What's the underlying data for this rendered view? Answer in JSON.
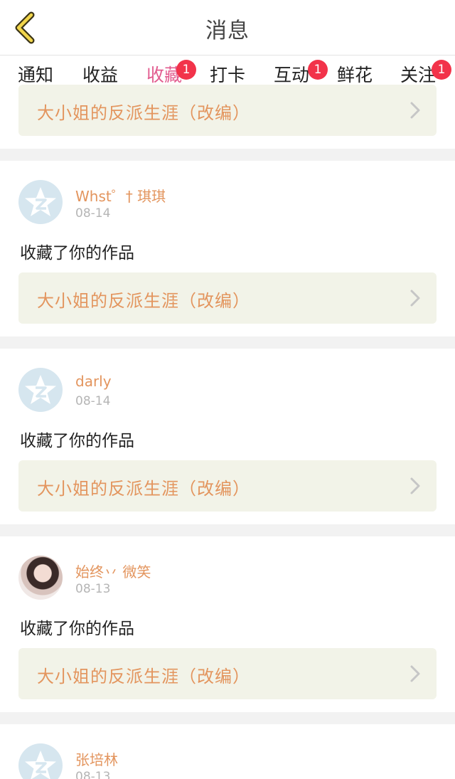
{
  "header": {
    "title": "消息"
  },
  "tabs": [
    {
      "label": "通知",
      "badge": ""
    },
    {
      "label": "收益",
      "badge": ""
    },
    {
      "label": "收藏",
      "badge": "1"
    },
    {
      "label": "打卡",
      "badge": ""
    },
    {
      "label": "互动",
      "badge": "1"
    },
    {
      "label": "鲜花",
      "badge": ""
    },
    {
      "label": "关注",
      "badge": "1"
    }
  ],
  "active_tab": "收藏",
  "colors": {
    "accent_pink": "#e25c8f",
    "badge_red": "#f2334a",
    "orange_text": "#e3955e",
    "work_box_bg": "#f2f3e8"
  },
  "messages": [
    {
      "user": "",
      "date": "",
      "action": "",
      "work_title": "大小姐的反派生涯（改编）"
    },
    {
      "user": "Whst゜† 琪琪",
      "date": "08-14",
      "action": "收藏了你的作品",
      "work_title": "大小姐的反派生涯（改编）"
    },
    {
      "user": "darly",
      "date": "08-14",
      "action": "收藏了你的作品",
      "work_title": "大小姐的反派生涯（改编）"
    },
    {
      "user": "始终丷 微笑",
      "date": "08-13",
      "action": "收藏了你的作品",
      "work_title": "大小姐的反派生涯（改编）"
    },
    {
      "user": "张培林",
      "date": "08-13",
      "action": "",
      "work_title": ""
    }
  ],
  "icons": {
    "back": "chevron-left-icon",
    "default_avatar": "qzone-star-icon",
    "work_arrow": "chevron-right-icon"
  }
}
